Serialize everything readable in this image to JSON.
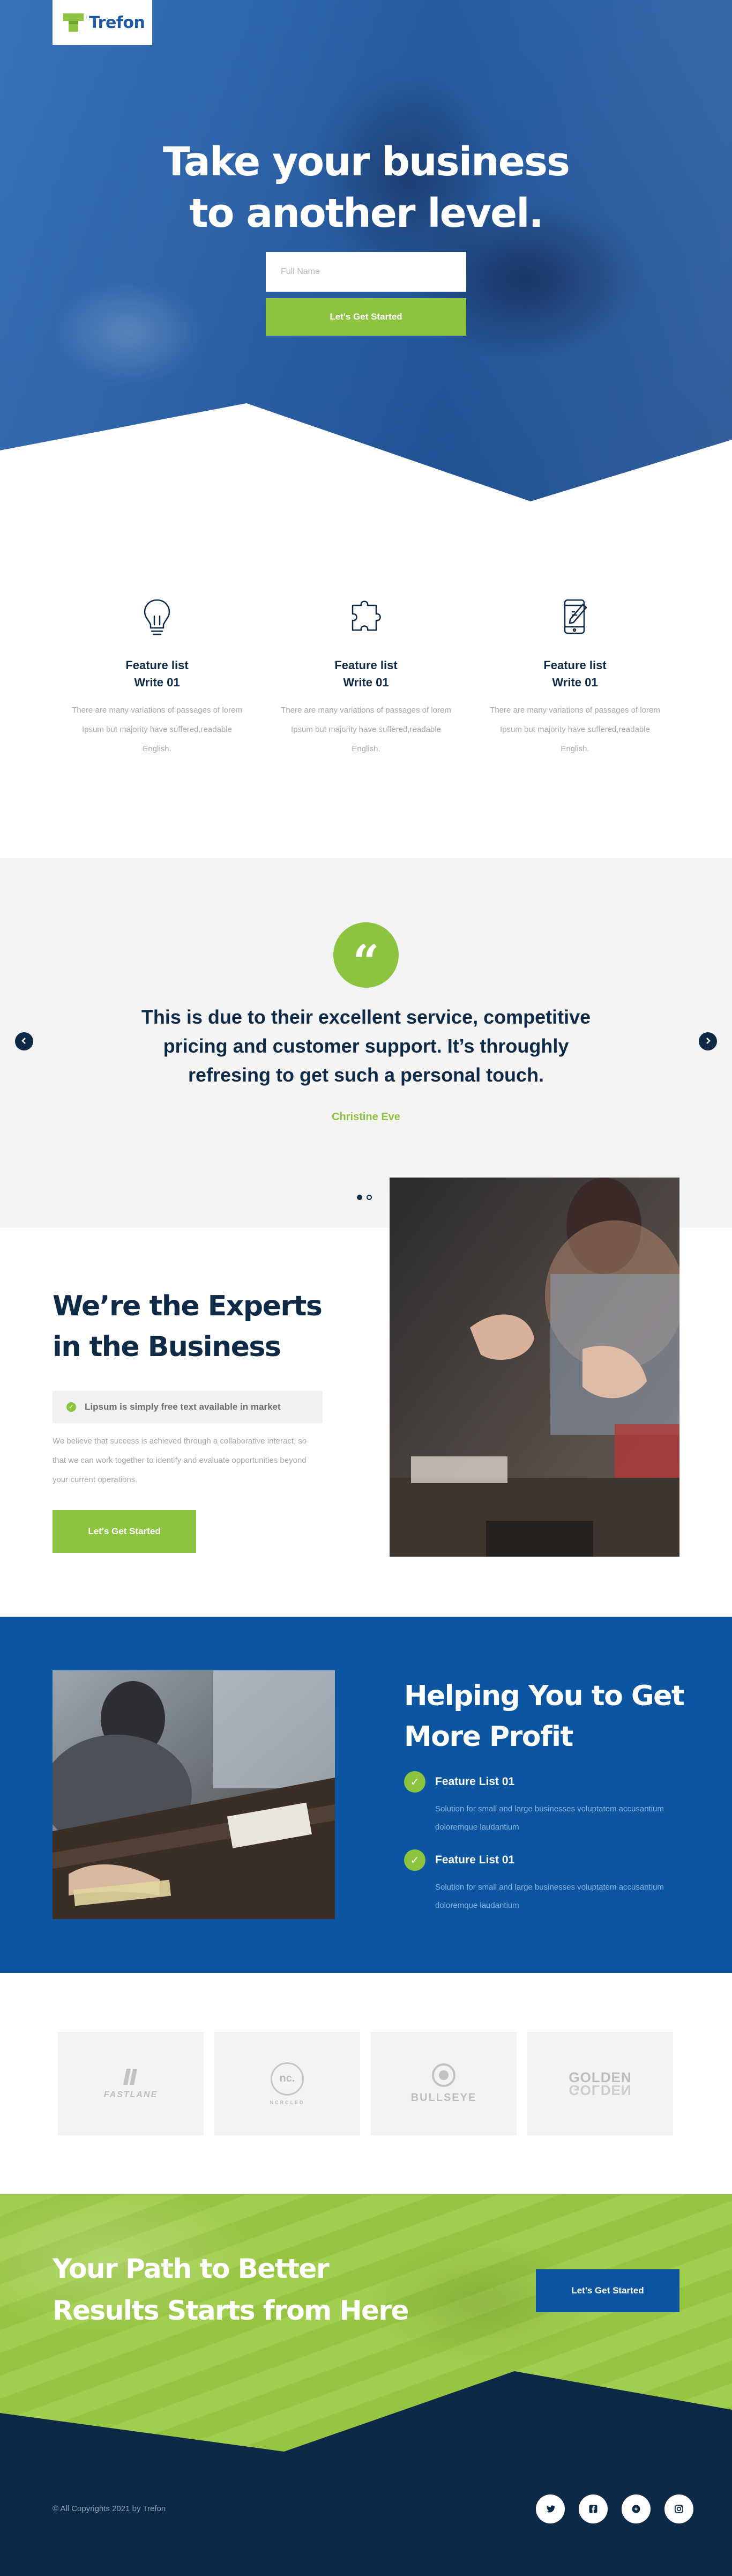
{
  "brand": {
    "name": "Trefon",
    "accent": "#8cc43f",
    "primary": "#0c55a1",
    "dark": "#0e2a47"
  },
  "hero": {
    "title_line1": "Take your business",
    "title_line2": "to another level.",
    "input_placeholder": "Full Name",
    "button_label": "Let's Get Started"
  },
  "features": [
    {
      "icon": "lightbulb-icon",
      "title_line1": "Feature list",
      "title_line2": "Write 01",
      "text": "There are many variations of passages of lorem Ipsum but majority have suffered,readable English."
    },
    {
      "icon": "puzzle-icon",
      "title_line1": "Feature list",
      "title_line2": "Write 01",
      "text": "There are many variations of passages of lorem Ipsum but majority have suffered,readable English."
    },
    {
      "icon": "mobile-edit-icon",
      "title_line1": "Feature list",
      "title_line2": "Write 01",
      "text": "There are many variations of passages of lorem Ipsum but majority have suffered,readable English."
    }
  ],
  "testimonial": {
    "quote_icon": "quote-icon",
    "line1": "This is due to their excellent service, competitive",
    "line2": "pricing and customer support. It’s throughly",
    "line3": "refresing to get such a personal touch.",
    "author": "Christine Eve",
    "slide_count": 2,
    "active_slide": 1
  },
  "experts": {
    "title_line1": "We’re the Experts",
    "title_line2": "in the Business",
    "tag": "Lipsum is simply free text available in market",
    "text": "We believe that success is achieved through a collaborative interact, so that we can work together to identify and evaluate opportunities beyond your current operations.",
    "button_label": "Let's Get Started"
  },
  "profit": {
    "title_line1": "Helping You to Get",
    "title_line2": "More Profit",
    "items": [
      {
        "title": "Feature List 01",
        "text": "Solution for small and large businesses voluptatem accusantium doloremque laudantium"
      },
      {
        "title": "Feature List 01",
        "text": "Solution for small and large businesses voluptatem accusantium doloremque laudantium"
      }
    ]
  },
  "logos": {
    "fastlane": {
      "name": "FASTLANE"
    },
    "nc": {
      "mark": "nc.",
      "name": "NCRCLED"
    },
    "bullseye": {
      "name": "BULLSEYE"
    },
    "golden": {
      "name": "GOLDEN"
    }
  },
  "cta": {
    "title_line1": "Your Path to Better",
    "title_line2": "Results Starts from Here",
    "button_label": "Let's Get Started"
  },
  "footer": {
    "copyright": "© All Copyrights 2021 by Trefon",
    "socials": [
      "twitter-icon",
      "facebook-icon",
      "dribbble-icon",
      "instagram-icon"
    ]
  }
}
